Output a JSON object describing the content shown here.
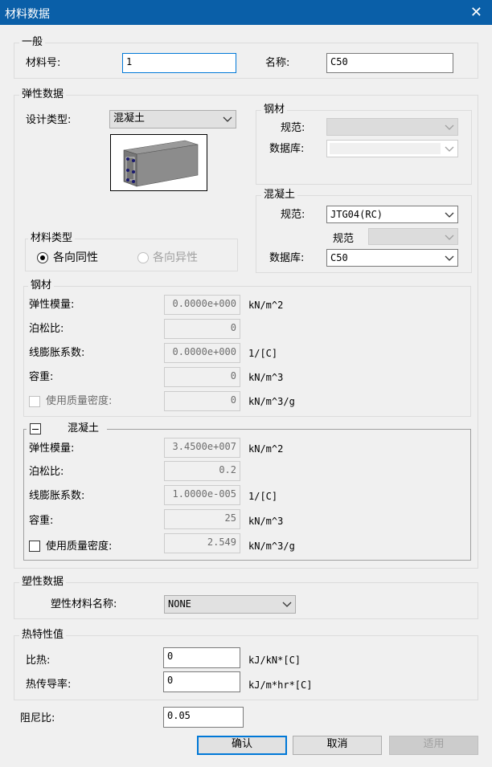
{
  "window": {
    "title": "材料数据",
    "close_glyph": "✕"
  },
  "general": {
    "group_label": "一般",
    "material_no_label": "材料号:",
    "material_no_value": "1",
    "name_label": "名称:",
    "name_value": "C50"
  },
  "elastic": {
    "group_label": "弹性数据",
    "design_type_label": "设计类型:",
    "design_type_value": "混凝土",
    "material_type": {
      "group_label": "材料类型",
      "isotropic": "各向同性",
      "anisotropic": "各向异性"
    },
    "steel_box": {
      "group_label": "钢材",
      "code_label": "规范:",
      "db_label": "数据库:"
    },
    "concrete_box": {
      "group_label": "混凝土",
      "code_label": "规范:",
      "code_value": "JTG04(RC)",
      "sub_code_label": "规范",
      "db_label": "数据库:",
      "db_value": "C50"
    },
    "steel_props": {
      "group_label": "钢材",
      "modulus_label": "弹性模量:",
      "modulus_value": "0.0000e+000",
      "modulus_unit": "kN/m^2",
      "poisson_label": "泊松比:",
      "poisson_value": "0",
      "thermal_label": "线膨胀系数:",
      "thermal_value": "0.0000e+000",
      "thermal_unit": "1/[C]",
      "weight_label": "容重:",
      "weight_value": "0",
      "weight_unit": "kN/m^3",
      "mass_label": "使用质量密度:",
      "mass_value": "0",
      "mass_unit": "kN/m^3/g"
    },
    "concrete_props": {
      "group_label": "混凝土",
      "collapse_glyph": "−",
      "modulus_label": "弹性模量:",
      "modulus_value": "3.4500e+007",
      "modulus_unit": "kN/m^2",
      "poisson_label": "泊松比:",
      "poisson_value": "0.2",
      "thermal_label": "线膨胀系数:",
      "thermal_value": "1.0000e-005",
      "thermal_unit": "1/[C]",
      "weight_label": "容重:",
      "weight_value": "25",
      "weight_unit": "kN/m^3",
      "mass_label": "使用质量密度:",
      "mass_value": "2.549",
      "mass_unit": "kN/m^3/g"
    }
  },
  "plastic": {
    "group_label": "塑性数据",
    "name_label": "塑性材料名称:",
    "name_value": "NONE"
  },
  "thermal": {
    "group_label": "热特性值",
    "specific_heat_label": "比热:",
    "specific_heat_value": "0",
    "specific_heat_unit": "kJ/kN*[C]",
    "conductivity_label": "热传导率:",
    "conductivity_value": "0",
    "conductivity_unit": "kJ/m*hr*[C]"
  },
  "damping": {
    "label": "阻尼比:",
    "value": "0.05"
  },
  "buttons": {
    "ok": "确认",
    "cancel": "取消",
    "apply": "适用"
  },
  "colors": {
    "titlebar": "#0a5fa8",
    "focus": "#0078d7",
    "panel": "#f0f0f0"
  }
}
